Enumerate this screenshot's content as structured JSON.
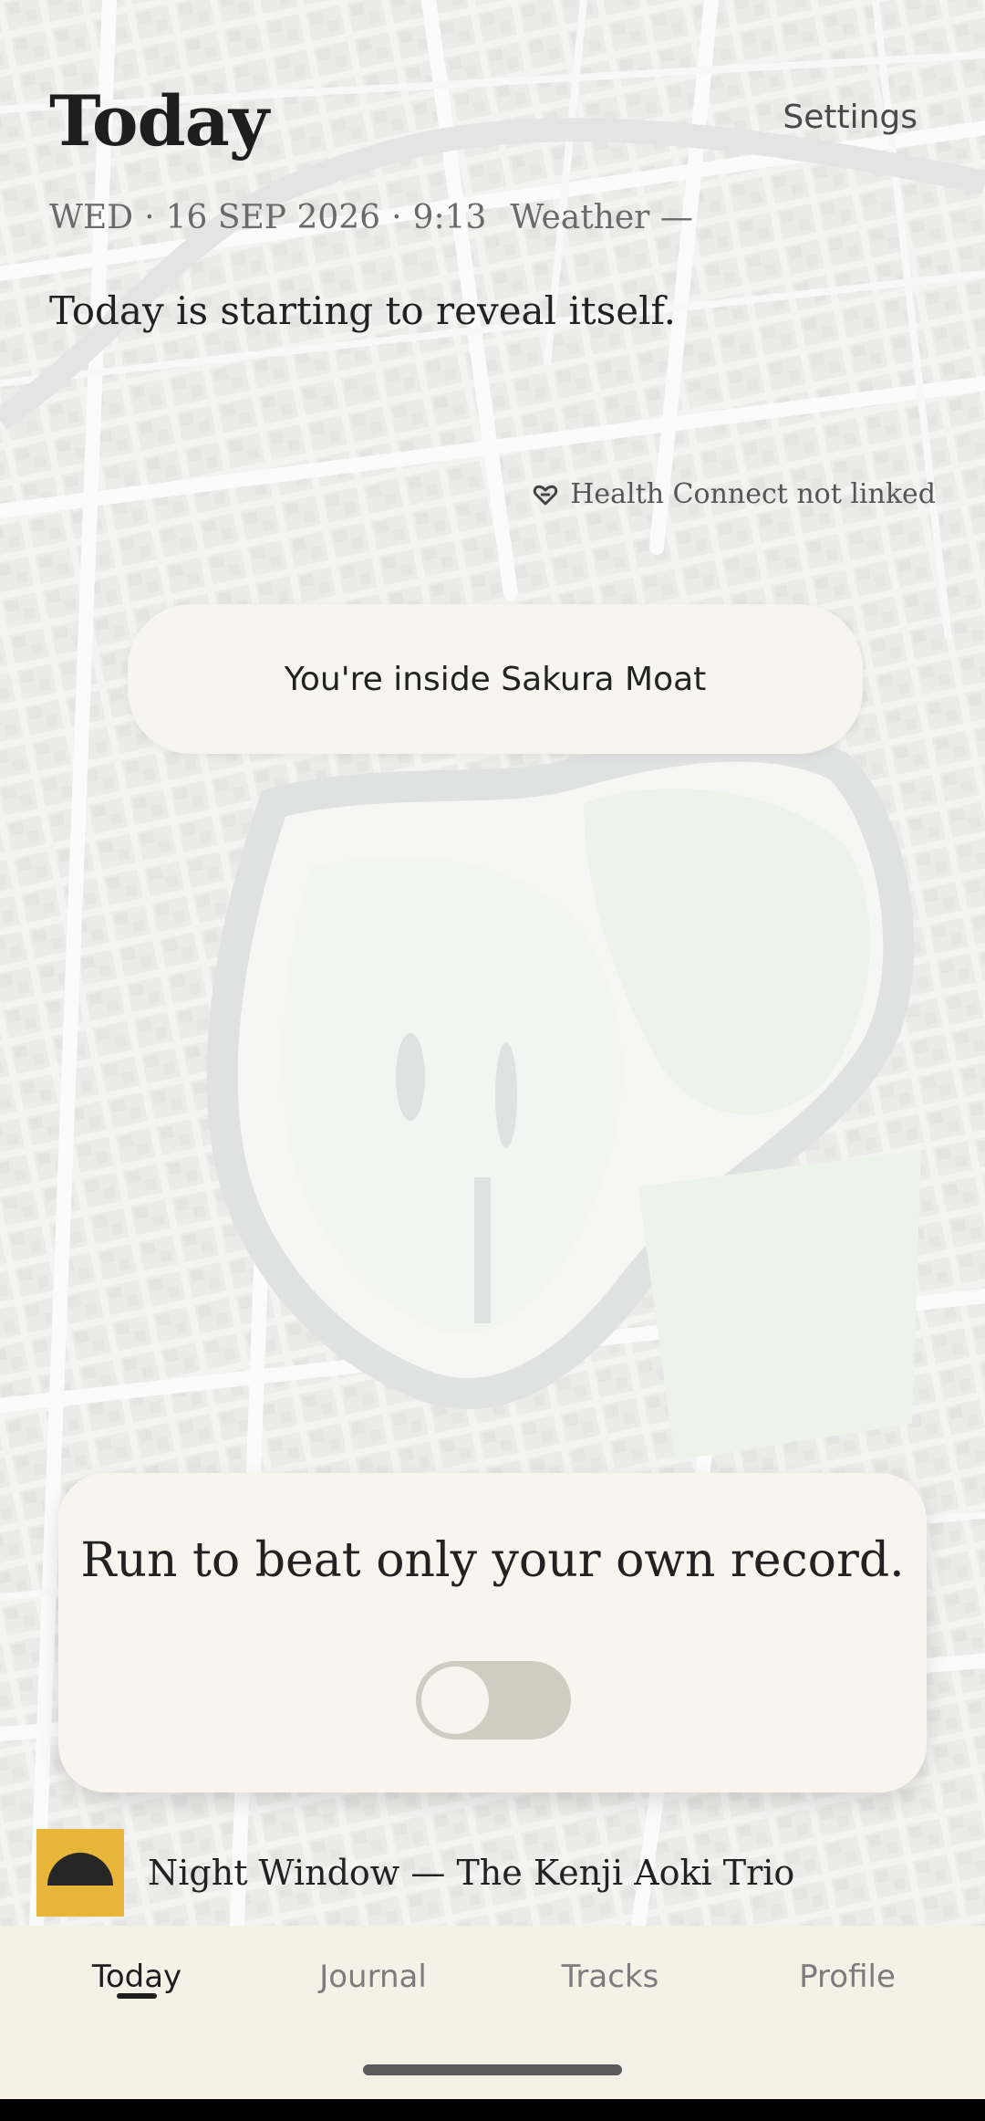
{
  "header": {
    "title": "Today",
    "settings_label": "Settings"
  },
  "dateline": {
    "weekday": "WED",
    "date": "16 SEP 2026",
    "time": "9:13",
    "weather": "Weather —"
  },
  "tagline": "Today is starting to reveal itself.",
  "health": {
    "icon": "heart-link-icon",
    "label": "Health Connect not linked"
  },
  "location_banner": "You're inside Sakura Moat",
  "run_card": {
    "title": "Run to beat only your own record.",
    "toggle_on": false
  },
  "now_playing": {
    "track": "Night Window — The Kenji Aoki Trio",
    "art_color": "#e8b63b"
  },
  "tabs": [
    {
      "label": "Today",
      "active": true
    },
    {
      "label": "Journal",
      "active": false
    },
    {
      "label": "Tracks",
      "active": false
    },
    {
      "label": "Profile",
      "active": false
    }
  ],
  "colors": {
    "background": "#efefed",
    "card": "#f7f5ee",
    "accent": "#e8b63b",
    "toggle_track": "#d0ccc2",
    "moat": "#d5d6d6",
    "park": "#e6ede3"
  }
}
